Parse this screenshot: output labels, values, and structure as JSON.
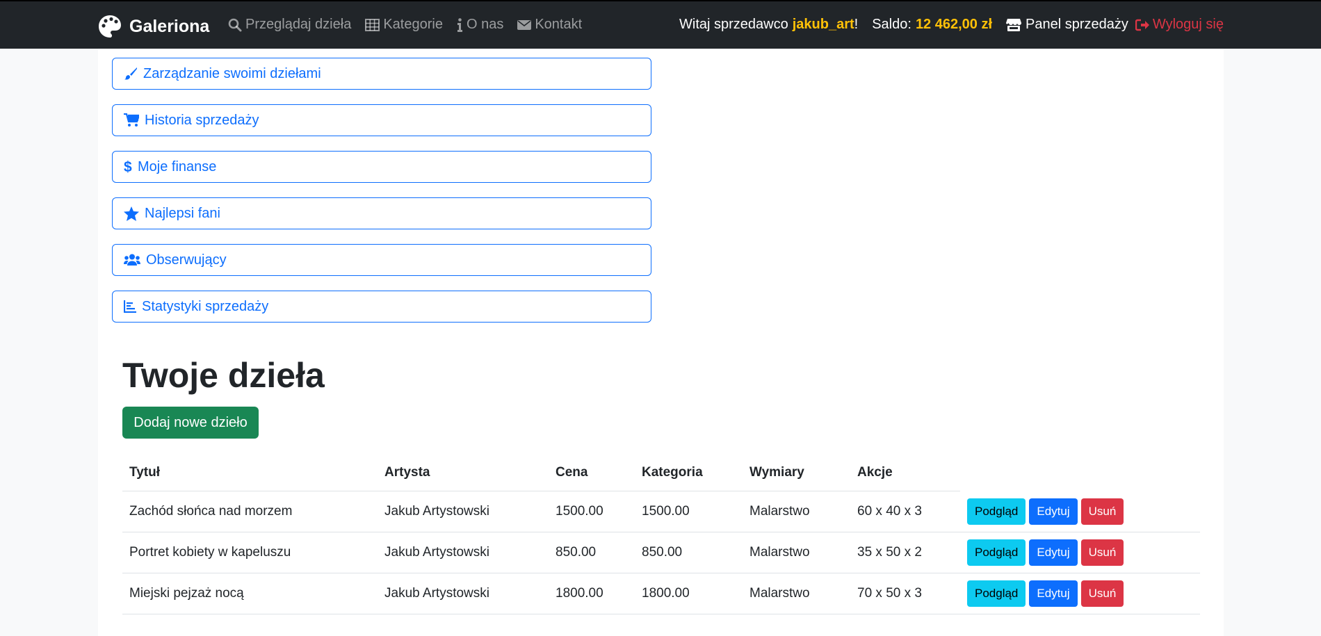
{
  "brand": {
    "name": "Galeriona"
  },
  "nav": {
    "browse": "Przeglądaj dzieła",
    "categories": "Kategorie",
    "about": "O nas",
    "contact": "Kontakt"
  },
  "user": {
    "greeting": "Witaj sprzedawco",
    "username": "jakub_art",
    "exclaim": "!",
    "balance_label": "Saldo:",
    "balance": "12 462,00 zł",
    "panel": "Panel sprzedaży",
    "logout": "Wyloguj się"
  },
  "menu": [
    {
      "label": "Zarządzanie swoimi dziełami",
      "icon": "paintbrush-icon"
    },
    {
      "label": "Historia sprzedaży",
      "icon": "cart-icon"
    },
    {
      "label": "Moje finanse",
      "icon": "dollar-icon"
    },
    {
      "label": "Najlepsi fani",
      "icon": "star-icon"
    },
    {
      "label": "Obserwujący",
      "icon": "users-icon"
    },
    {
      "label": "Statystyki sprzedaży",
      "icon": "chart-icon"
    }
  ],
  "main": {
    "title": "Twoje dzieła",
    "add_button": "Dodaj nowe dzieło"
  },
  "table": {
    "headers": [
      "Tytuł",
      "Artysta",
      "Cena",
      "Kategoria",
      "Wymiary",
      "Akcje"
    ],
    "rows": [
      [
        "Zachód słońca nad morzem",
        "Jakub Artystowski",
        "1500.00",
        "1500.00",
        "Malarstwo",
        "60 x 40 x 3"
      ],
      [
        "Portret kobiety w kapeluszu",
        "Jakub Artystowski",
        "850.00",
        "850.00",
        "Malarstwo",
        "35 x 50 x 2"
      ],
      [
        "Miejski pejzaż nocą",
        "Jakub Artystowski",
        "1800.00",
        "1800.00",
        "Malarstwo",
        "70 x 50 x 3"
      ]
    ],
    "actions": {
      "preview": "Podgląd",
      "edit": "Edytuj",
      "delete": "Usuń"
    }
  },
  "colors": {
    "primary": "#0d6efd",
    "success": "#198754",
    "info": "#0dcaf0",
    "danger": "#dc3545",
    "warning": "#ffc107",
    "navbar": "#212529"
  }
}
